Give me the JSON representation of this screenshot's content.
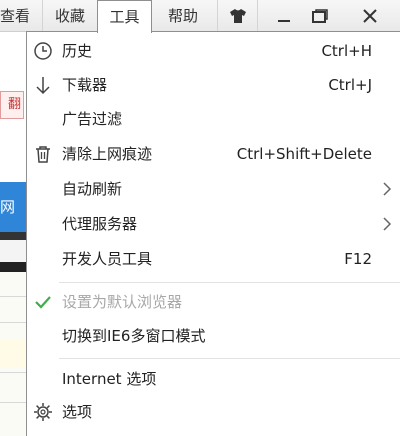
{
  "menubar": {
    "items": [
      {
        "label": "查看"
      },
      {
        "label": "收藏"
      },
      {
        "label": "工具"
      },
      {
        "label": "帮助"
      }
    ]
  },
  "background": {
    "tag_text": "翻",
    "blue_text": "网站"
  },
  "tools_menu": {
    "items": [
      {
        "label": "历史",
        "shortcut": "Ctrl+H",
        "icon": "clock-icon"
      },
      {
        "label": "下载器",
        "shortcut": "Ctrl+J",
        "icon": "download-arrow-icon"
      },
      {
        "label": "广告过滤",
        "shortcut": ""
      },
      {
        "label": "清除上网痕迹",
        "shortcut": "Ctrl+Shift+Delete",
        "icon": "trash-icon"
      },
      {
        "label": "自动刷新",
        "submenu": true
      },
      {
        "label": "代理服务器",
        "submenu": true
      },
      {
        "label": "开发人员工具",
        "shortcut": "F12"
      },
      {
        "label": "设置为默认浏览器",
        "disabled": true,
        "checked": true,
        "icon": "check-icon"
      },
      {
        "label": "切换到IE6多窗口模式"
      },
      {
        "label": "Internet 选项"
      },
      {
        "label": "选项",
        "icon": "gear-icon"
      }
    ]
  },
  "colors": {
    "accent_blue": "#2f86d9",
    "check_green": "#3fae49"
  }
}
